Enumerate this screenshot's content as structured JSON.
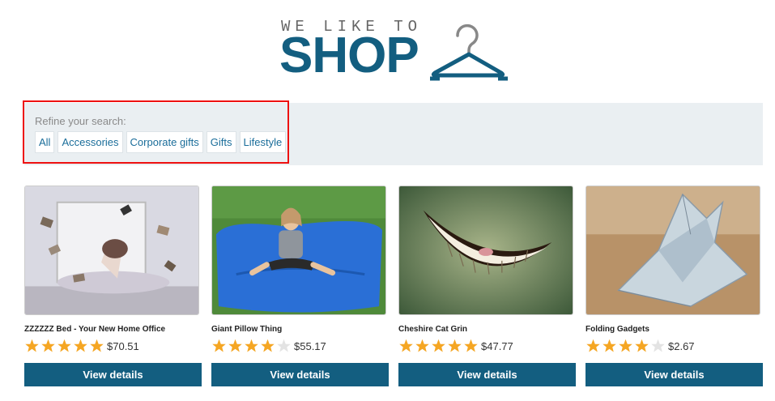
{
  "logo": {
    "tagline": "WE LIKE TO",
    "main": "SHOP",
    "icon": "hanger-icon"
  },
  "filter": {
    "label": "Refine your search:",
    "options": [
      "All",
      "Accessories",
      "Corporate gifts",
      "Gifts",
      "Lifestyle"
    ]
  },
  "products": [
    {
      "name": "ZZZZZZ Bed - Your New Home Office",
      "rating": 5,
      "price": "$70.51",
      "button": "View details"
    },
    {
      "name": "Giant Pillow Thing",
      "rating": 4,
      "price": "$55.17",
      "button": "View details"
    },
    {
      "name": "Cheshire Cat Grin",
      "rating": 5,
      "price": "$47.77",
      "button": "View details"
    },
    {
      "name": "Folding Gadgets",
      "rating": 4,
      "price": "$2.67",
      "button": "View details"
    }
  ],
  "colors": {
    "brand": "#135e80",
    "star_on": "#f5a623",
    "star_off": "#e3e3e3",
    "highlight": "#ee1111"
  }
}
